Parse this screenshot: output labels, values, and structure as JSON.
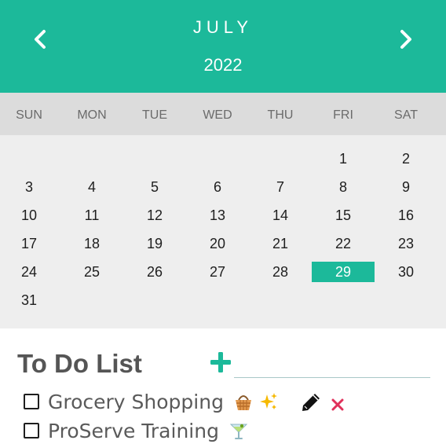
{
  "calendar": {
    "month": "JULY",
    "year": "2022",
    "weekdays": [
      "SUN",
      "MON",
      "TUE",
      "WED",
      "THU",
      "FRI",
      "SAT"
    ],
    "days": [
      "1",
      "2",
      "3",
      "4",
      "5",
      "6",
      "7",
      "8",
      "9",
      "10",
      "11",
      "12",
      "13",
      "14",
      "15",
      "16",
      "17",
      "18",
      "19",
      "20",
      "21",
      "22",
      "23",
      "24",
      "25",
      "26",
      "27",
      "28",
      "29",
      "30",
      "31"
    ],
    "selected_day": "29",
    "colors": {
      "accent": "#1cb99a",
      "weekday_bar": "#dcdcdc",
      "days_bg": "#eeeeee"
    }
  },
  "todo": {
    "title": "To Do List",
    "add_icon": "plus-icon",
    "input_value": "",
    "items": [
      {
        "text": "Grocery Shopping",
        "checked": false,
        "emojis": [
          "basket-icon",
          "sparkles-icon"
        ]
      },
      {
        "text": "ProServe Training",
        "checked": false,
        "emojis": [
          "cocktail-icon"
        ]
      }
    ],
    "edit_icon": "pencil-icon",
    "delete_icon": "close-icon",
    "colors": {
      "title": "#555555",
      "delete": "#e0305a"
    }
  }
}
